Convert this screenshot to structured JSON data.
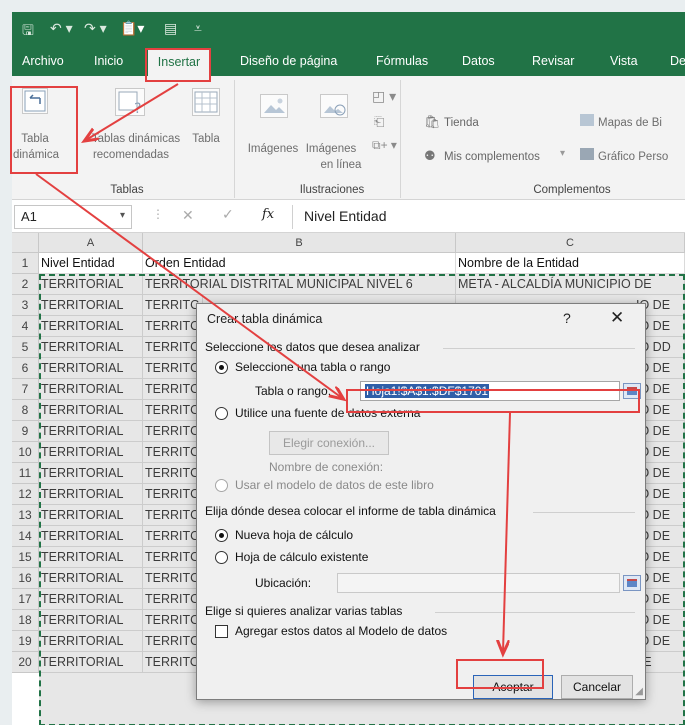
{
  "qat": {
    "save": "🖫",
    "undo": "↶ ▾",
    "redo": "↷ ▾",
    "paste": "📋▾",
    "form": "▤",
    "more": "⩡"
  },
  "tabs": [
    "Archivo",
    "Inicio",
    "Insertar",
    "Diseño de página",
    "Fórmulas",
    "Datos",
    "Revisar",
    "Vista",
    "De"
  ],
  "ribbon": {
    "tabla_dinamica_1": "Tabla",
    "tabla_dinamica_2": "dinámica",
    "tablas_dinamicas_1": "Tablas dinámicas",
    "tablas_dinamicas_2": "recomendadas",
    "tabla": "Tabla",
    "group_tablas": "Tablas",
    "imagenes": "Imágenes",
    "imagenes_linea_1": "Imágenes",
    "imagenes_linea_2": "en línea",
    "group_ilustraciones": "Ilustraciones",
    "tienda": "Tienda",
    "mis_complementos": "Mis complementos",
    "group_complementos": "Complementos",
    "mapas": "Mapas de Bi",
    "grafico": "Gráfico Perso"
  },
  "formula_bar": {
    "cell_ref": "A1",
    "fx": "fx",
    "value": "Nivel Entidad"
  },
  "columns": [
    "A",
    "B",
    "C"
  ],
  "header_row": [
    "Nivel Entidad",
    "Orden Entidad",
    "Nombre de la Entidad"
  ],
  "rows": [
    {
      "n": "1"
    },
    {
      "n": "2"
    },
    {
      "n": "3"
    },
    {
      "n": "4"
    },
    {
      "n": "5"
    },
    {
      "n": "6"
    },
    {
      "n": "7"
    },
    {
      "n": "8"
    },
    {
      "n": "9"
    },
    {
      "n": "10"
    },
    {
      "n": "11"
    },
    {
      "n": "12"
    },
    {
      "n": "13"
    },
    {
      "n": "14"
    },
    {
      "n": "15"
    },
    {
      "n": "16"
    },
    {
      "n": "17"
    },
    {
      "n": "18"
    },
    {
      "n": "19"
    },
    {
      "n": "20"
    }
  ],
  "cells": {
    "a": "TERRITORIAL",
    "b_row2": "TERRITORIAL DISTRITAL MUNICIPAL NIVEL 6",
    "b_row20": "TERRITORIAL DISTRITAL MUNICIPAL NIVEL 6",
    "b_partial": "TERRITC",
    "c_row2": "META - ALCALDÍA MUNICIPIO DE",
    "c_row20": "META - ALCALDÍA MUNICIPIO DE",
    "c_partial": "IO DE",
    "c_partial_dd": "IO DD"
  },
  "dialog": {
    "title": "Crear tabla dinámica",
    "help": "?",
    "close": "✕",
    "section1": "Seleccione los datos que desea analizar",
    "opt_rango": "Seleccione una tabla o rango",
    "label_rango": "Tabla o rango:",
    "rango_value": "Hoja1!$A$1:$DF$1701",
    "opt_externa": "Utilice una fuente de datos externa",
    "btn_conexion": "Elegir conexión...",
    "nombre_conexion": "Nombre de conexión:",
    "opt_modelo": "Usar el modelo de datos de este libro",
    "section2": "Elija dónde desea colocar el informe de tabla dinámica",
    "opt_nueva": "Nueva hoja de cálculo",
    "opt_existente": "Hoja de cálculo existente",
    "label_ubicacion": "Ubicación:",
    "section3": "Elige si quieres analizar varias tablas",
    "chk_modelo": "Agregar estos datos al Modelo de datos",
    "btn_aceptar": "Aceptar",
    "btn_cancelar": "Cancelar"
  },
  "colors": {
    "excel_green": "#217346",
    "highlight": "#e34040"
  }
}
